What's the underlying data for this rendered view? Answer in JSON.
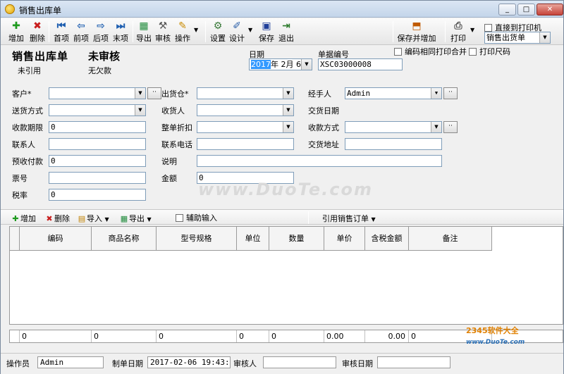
{
  "window": {
    "title": "销售出库单",
    "controls": [
      "_",
      "□",
      "✕"
    ]
  },
  "toolbar": {
    "add": "增加",
    "delete": "删除",
    "first": "首项",
    "prev": "前项",
    "next": "后项",
    "last": "末项",
    "export": "导出",
    "audit": "审核",
    "operate": "操作",
    "settings": "设置",
    "design": "设计",
    "save": "保存",
    "exit": "退出",
    "save_and_add": "保存并增加",
    "print": "打印",
    "direct_print_label": "直接到打印机",
    "print_template": "销售出货单",
    "merge_same_code_label": "编码相同打印合并",
    "print_size_code_label": "打印尺码"
  },
  "header": {
    "doc_title": "销售出库单",
    "doc_status": "未审核",
    "ref_status": "未引用",
    "payment_status": "无欠款",
    "date_label": "日期",
    "date_year": "2017",
    "date_rest": "年 2月 6日",
    "doc_no_label": "单据编号",
    "doc_no": "XSC03000008"
  },
  "form": {
    "customer_label": "客户*",
    "warehouse_label": "出货仓*",
    "handler_label": "经手人",
    "handler_value": "Admin",
    "delivery_method_label": "送货方式",
    "receiver_label": "收货人",
    "delivery_date_label": "交货日期",
    "payment_term_label": "收款期限",
    "payment_term_value": "0",
    "discount_label": "整单折扣",
    "payment_method_label": "收款方式",
    "contact_label": "联系人",
    "contact_phone_label": "联系电话",
    "delivery_address_label": "交货地址",
    "advance_label": "预收付款",
    "advance_value": "0",
    "note_label": "说明",
    "ticket_label": "票号",
    "amount_label": "金额",
    "amount_value": "0",
    "tax_label": "税率",
    "tax_value": "0"
  },
  "watermark": "www.DuoTe.com",
  "detail_toolbar": {
    "add": "增加",
    "delete": "删除",
    "import": "导入",
    "export": "导出",
    "assist_input": "辅助输入",
    "ref_order": "引用销售订单"
  },
  "grid": {
    "columns": [
      "编码",
      "商品名称",
      "型号规格",
      "单位",
      "数量",
      "单价",
      "含税金额",
      "备注"
    ]
  },
  "totals": [
    "0",
    "0",
    "0",
    "0",
    "0",
    "0.00",
    "0.00",
    "0"
  ],
  "statusbar": {
    "operator_label": "操作员",
    "operator_value": "Admin",
    "created_label": "制单日期",
    "created_value": "2017-02-06 19:43:00",
    "auditor_label": "审核人",
    "audit_date_label": "审核日期"
  },
  "corner_logo": {
    "brand": "2345软件大全",
    "site": "www.DuoTe.com"
  },
  "colors": {
    "titlebar": "#c4d5ea",
    "selection": "#3399ff",
    "link_blue": "#2a6fb5"
  }
}
